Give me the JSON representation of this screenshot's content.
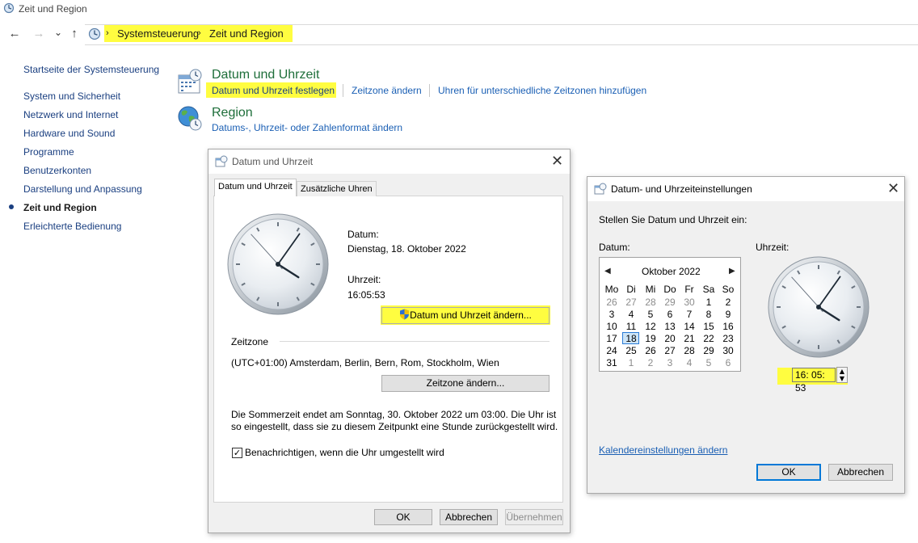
{
  "window": {
    "title": "Zeit und Region"
  },
  "addressbar": {
    "crumbs": [
      "Systemsteuerung",
      "Zeit und Region"
    ],
    "back": "←",
    "forward": "→",
    "dropdown": "⌄",
    "up": "↑"
  },
  "sidebar": {
    "home": "Startseite der Systemsteuerung",
    "items": [
      "System und Sicherheit",
      "Netzwerk und Internet",
      "Hardware und Sound",
      "Programme",
      "Benutzerkonten",
      "Darstellung und Anpassung",
      "Zeit und Region",
      "Erleichterte Bedienung"
    ],
    "active_index": 6
  },
  "categories": {
    "datetime": {
      "title": "Datum und Uhrzeit",
      "links": [
        "Datum und Uhrzeit festlegen",
        "Zeitzone ändern",
        "Uhren für unterschiedliche Zeitzonen hinzufügen"
      ]
    },
    "region": {
      "title": "Region",
      "links": [
        "Datums-, Uhrzeit- oder Zahlenformat ändern"
      ]
    }
  },
  "dialog_datetime": {
    "title": "Datum und Uhrzeit",
    "tabs": [
      "Datum und Uhrzeit",
      "Zusätzliche Uhren"
    ],
    "date_label": "Datum:",
    "date_value": "Dienstag, 18. Oktober 2022",
    "time_label": "Uhrzeit:",
    "time_value": "16:05:53",
    "change_button": "Datum und Uhrzeit ändern...",
    "timezone_heading": "Zeitzone",
    "timezone_value": "(UTC+01:00) Amsterdam, Berlin, Bern, Rom, Stockholm, Wien",
    "timezone_button": "Zeitzone ändern...",
    "dst_line1": "Die Sommerzeit endet am Sonntag, 30. Oktober 2022 um 03:00. Die Uhr ist",
    "dst_line2": "so eingestellt, dass sie zu diesem Zeitpunkt eine Stunde zurückgestellt wird.",
    "notify_checkbox": "Benachrichtigen, wenn die Uhr umgestellt wird",
    "notify_checked": true,
    "check_mark": "✓",
    "ok": "OK",
    "cancel": "Abbrechen",
    "apply": "Übernehmen",
    "close": "✕"
  },
  "dialog_settings": {
    "title": "Datum- und Uhrzeiteinstellungen",
    "instruction": "Stellen Sie Datum und Uhrzeit ein:",
    "date_label": "Datum:",
    "time_label": "Uhrzeit:",
    "calendar": {
      "month": "Oktober 2022",
      "prev": "◀",
      "next": "▶",
      "weekdays": [
        "Mo",
        "Di",
        "Mi",
        "Do",
        "Fr",
        "Sa",
        "So"
      ],
      "weeks": [
        [
          "26",
          "27",
          "28",
          "29",
          "30",
          "1",
          "2"
        ],
        [
          "3",
          "4",
          "5",
          "6",
          "7",
          "8",
          "9"
        ],
        [
          "10",
          "11",
          "12",
          "13",
          "14",
          "15",
          "16"
        ],
        [
          "17",
          "18",
          "19",
          "20",
          "21",
          "22",
          "23"
        ],
        [
          "24",
          "25",
          "26",
          "27",
          "28",
          "29",
          "30"
        ],
        [
          "31",
          "1",
          "2",
          "3",
          "4",
          "5",
          "6"
        ]
      ],
      "selected": "18"
    },
    "time_input": "16: 05: 53",
    "spin_up": "▲",
    "spin_down": "▼",
    "calendar_link": "Kalendereinstellungen ändern",
    "ok": "OK",
    "cancel": "Abbrechen",
    "close": "✕"
  },
  "clock": {
    "hours": 16,
    "minutes": 5,
    "seconds": 53
  },
  "colors": {
    "highlight": "#fffd40",
    "link": "#1a5fb4",
    "category": "#1e6e3a",
    "selection": "#2a7bd6"
  }
}
